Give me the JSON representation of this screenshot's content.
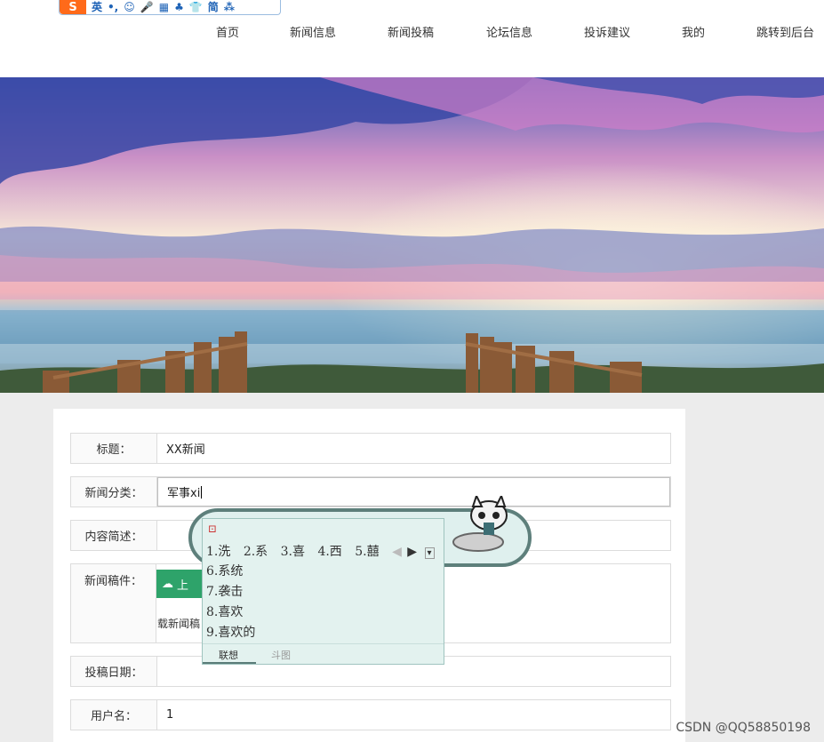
{
  "ime_toolbar": {
    "logo": "S",
    "mode": "英",
    "punct": "•,",
    "items": [
      "☺",
      "🎤",
      "▦",
      "♣",
      "👕",
      "简",
      "⁂"
    ]
  },
  "nav": {
    "items": [
      "首页",
      "新闻信息",
      "新闻投稿",
      "论坛信息",
      "投诉建议",
      "我的",
      "跳转到后台"
    ]
  },
  "form": {
    "title_label": "标题：",
    "title_value": "XX新闻",
    "category_label": "新闻分类：",
    "category_value": "军事xi",
    "summary_label": "内容简述：",
    "manuscript_label": "新闻稿件：",
    "upload_label": "上",
    "upload_note": "载新闻稿",
    "date_label": "投稿日期：",
    "user_label": "用户名：",
    "user_value": "1"
  },
  "ime_popup": {
    "candidates_top": [
      "1.洗",
      "2.系",
      "3.喜",
      "4.西",
      "5.囍"
    ],
    "candidates_list": [
      "6.系统",
      "7.袭击",
      "8.喜欢",
      "9.喜欢的"
    ],
    "tabs": [
      "联想",
      "斗图"
    ]
  },
  "watermark": "CSDN @QQ58850198",
  "colors": {
    "upload_green": "#2ea36a",
    "ime_teal": "#5d7f7b"
  }
}
